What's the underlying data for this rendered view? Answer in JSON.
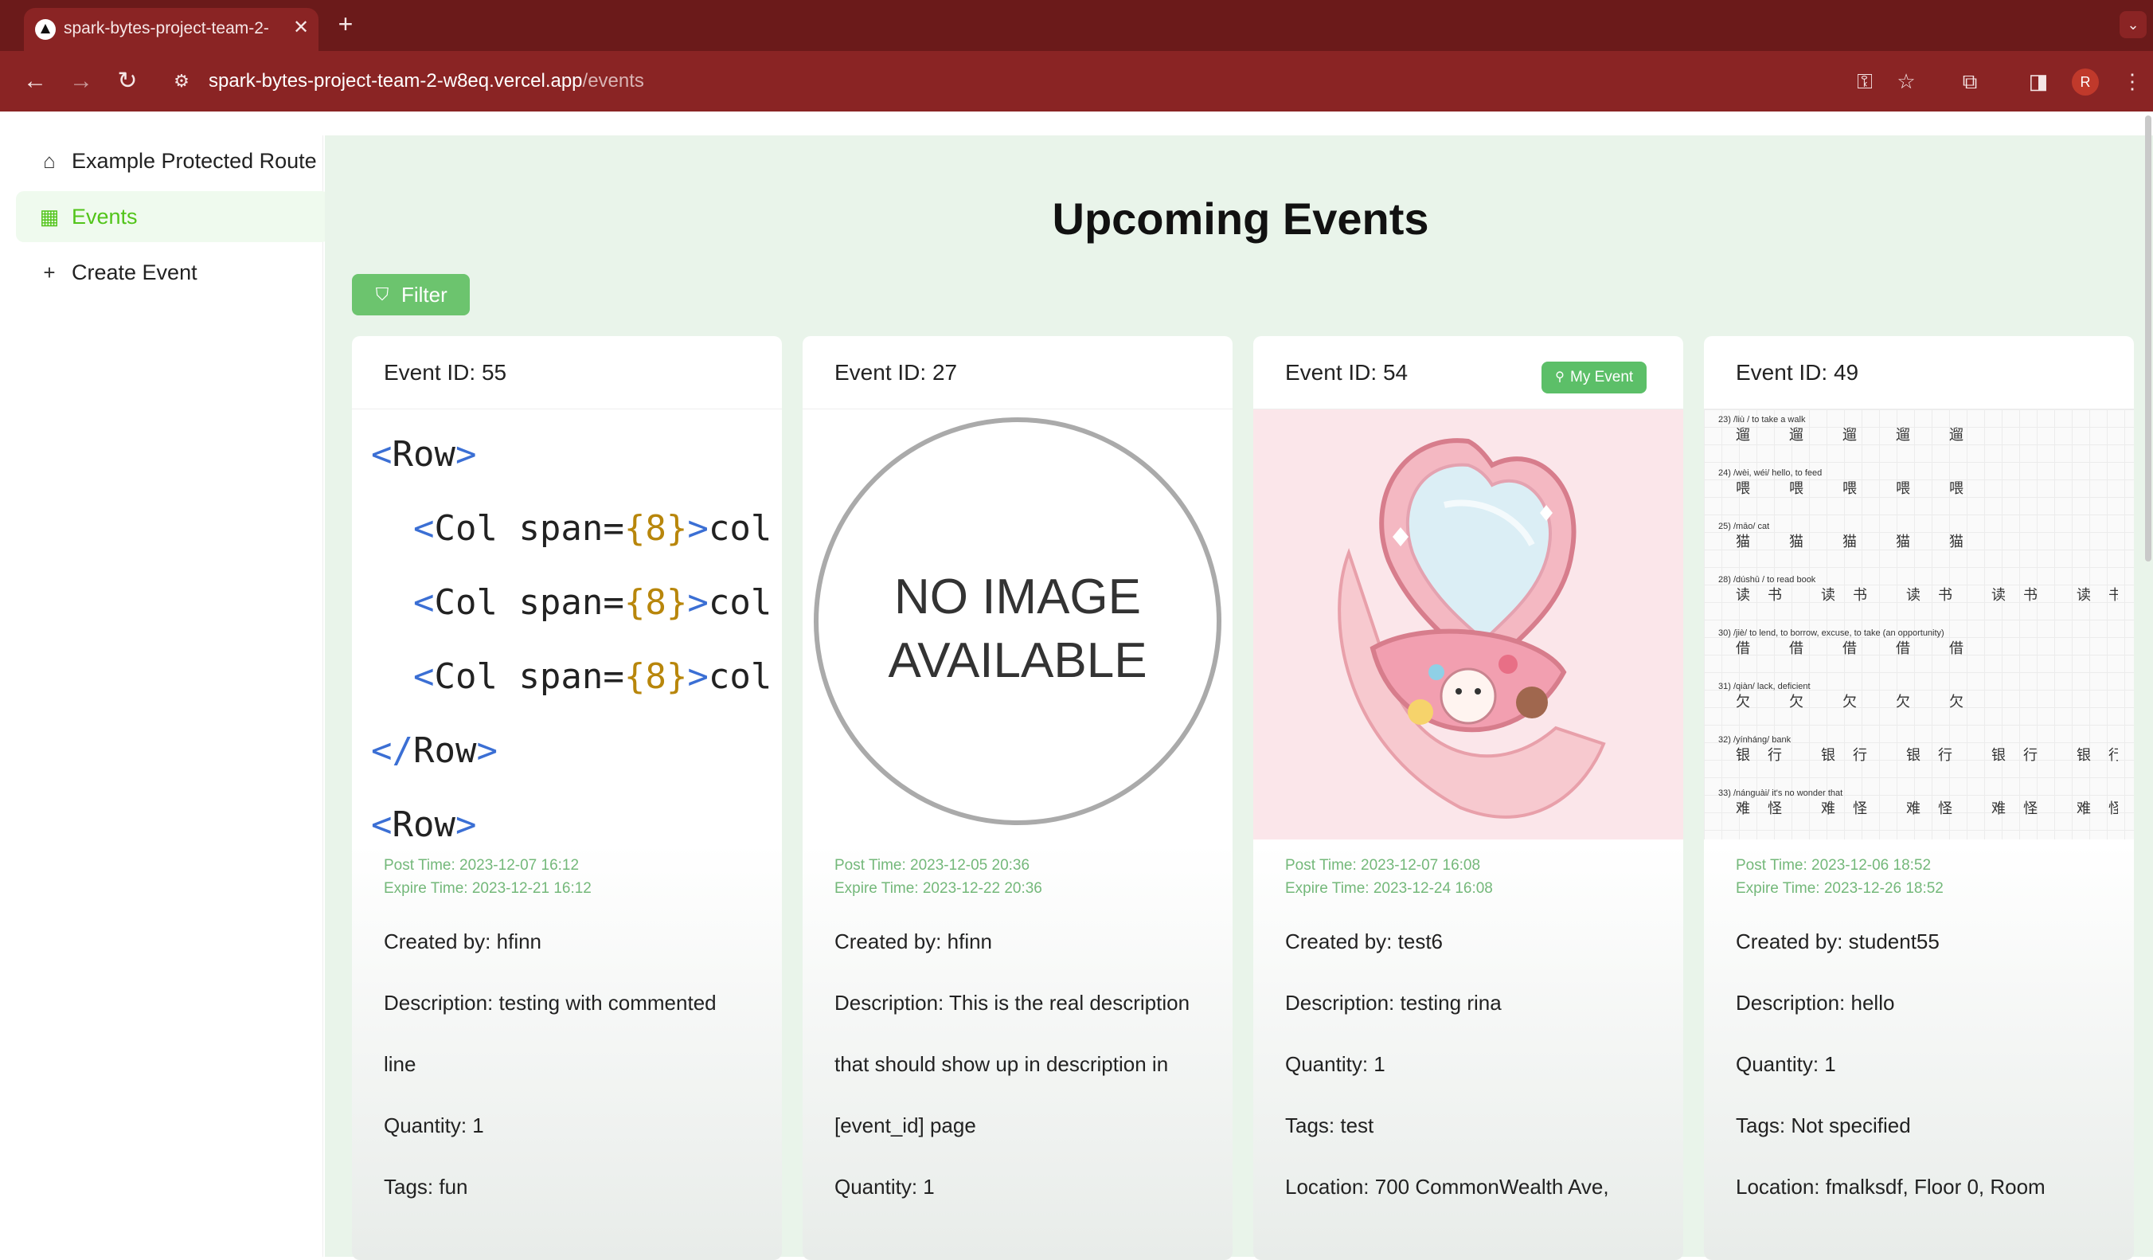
{
  "browser": {
    "tab_title": "spark-bytes-project-team-2-",
    "tab_close": "✕",
    "new_tab": "+",
    "url_host": "spark-bytes-project-team-2-w8eq.vercel.app",
    "url_path": "/events",
    "avatar_letter": "R"
  },
  "sidebar": {
    "items": [
      {
        "icon": "home-icon",
        "label": "Example Protected Route",
        "active": false
      },
      {
        "icon": "calendar-icon",
        "label": "Events",
        "active": true
      },
      {
        "icon": "plus-icon",
        "label": "Create Event",
        "active": false
      }
    ]
  },
  "main": {
    "title": "Upcoming Events",
    "filter_label": "Filter"
  },
  "cards": [
    {
      "id_label": "Event ID: 55",
      "image": "code-snippet",
      "post_time": "Post Time: 2023-12-07 16:12",
      "expire_time": "Expire Time: 2023-12-21 16:12",
      "fields": [
        "Created by: hfinn",
        "Description: testing with commented",
        "line",
        "Quantity: 1",
        "Tags: fun"
      ]
    },
    {
      "id_label": "Event ID: 27",
      "image": "no-image",
      "no_image_text_1": "NO IMAGE",
      "no_image_text_2": "AVAILABLE",
      "post_time": "Post Time: 2023-12-05 20:36",
      "expire_time": "Expire Time: 2023-12-22 20:36",
      "fields": [
        "Created by: hfinn",
        "Description: This is the real description",
        "that should show up in description in",
        "[event_id] page",
        "Quantity: 1"
      ]
    },
    {
      "id_label": "Event ID: 54",
      "badge": "My Event",
      "image": "illustration",
      "post_time": "Post Time: 2023-12-07 16:08",
      "expire_time": "Expire Time: 2023-12-24 16:08",
      "fields": [
        "Created by: test6",
        "Description: testing rina",
        "Quantity: 1",
        "Tags: test",
        "Location: 700 CommonWealth Ave,"
      ]
    },
    {
      "id_label": "Event ID: 49",
      "image": "handwriting",
      "post_time": "Post Time: 2023-12-06 18:52",
      "expire_time": "Expire Time: 2023-12-26 18:52",
      "fields": [
        "Created by: student55",
        "Description: hello",
        "Quantity: 1",
        "Tags: Not specified",
        "Location: fmalksdf, Floor 0, Room"
      ]
    }
  ],
  "code_lines": [
    {
      "open": "<",
      "tag": "Row",
      "close": ">"
    },
    {
      "indent": "  ",
      "open": "<",
      "tag": "Col span=",
      "num": "{8}",
      "close": ">col"
    },
    {
      "indent": "  ",
      "open": "<",
      "tag": "Col span=",
      "num": "{8}",
      "close": ">col"
    },
    {
      "indent": "  ",
      "open": "<",
      "tag": "Col span=",
      "num": "{8}",
      "close": ">col"
    },
    {
      "open": "</",
      "tag": "Row",
      "close": ">"
    },
    {
      "open": "<",
      "tag": "Row",
      "close": ">"
    }
  ],
  "handwriting": [
    {
      "note": "23) /liù / to take a walk",
      "chars": "遛 遛 遛 遛 遛"
    },
    {
      "note": "24) /wèi, wéi/ hello, to feed",
      "chars": "喂 喂 喂 喂 喂"
    },
    {
      "note": "25) /māo/ cat",
      "chars": "猫 猫 猫 猫 猫"
    },
    {
      "note": "28) /dúshū / to read book",
      "chars": "读书 读书 读书 读书 读书"
    },
    {
      "note": "30) /jiè/ to lend, to borrow, excuse, to take (an opportunity)",
      "chars": "借 借 借 借 借"
    },
    {
      "note": "31) /qiàn/ lack, deficient",
      "chars": "欠 欠 欠 欠 欠"
    },
    {
      "note": "32) /yínháng/ bank",
      "chars": "银行 银行 银行 银行 银行"
    },
    {
      "note": "33) /nánguài/ it's no wonder that",
      "chars": "难怪 难怪 难怪 难怪 难怪"
    }
  ]
}
